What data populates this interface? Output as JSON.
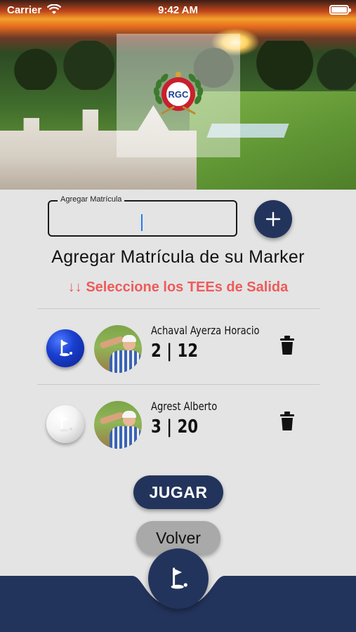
{
  "status_bar": {
    "carrier": "Carrier",
    "time": "9:42 AM"
  },
  "header": {
    "logo_text": "RGC"
  },
  "matricula_input": {
    "label": "Agregar Matrícula",
    "value": ""
  },
  "heading": "Agregar Matrícula de su Marker",
  "tees_note": "↓↓ Seleccione los TEEs de Salida",
  "players": [
    {
      "name": "Achaval Ayerza Horacio",
      "stats": "2 | 12",
      "tee_color": "blue"
    },
    {
      "name": "Agrest Alberto",
      "stats": "3 | 20",
      "tee_color": "white"
    }
  ],
  "buttons": {
    "jugar": "JUGAR",
    "volver": "Volver"
  },
  "colors": {
    "primary_navy": "#23345c",
    "accent_red": "#ef5a5a",
    "background": "#e4e4e4",
    "secondary_button": "#a9a9a9"
  },
  "icons": {
    "add": "plus-icon",
    "delete": "trash-icon",
    "tee": "golf-flag-icon",
    "tab_center": "golf-flag-icon"
  }
}
